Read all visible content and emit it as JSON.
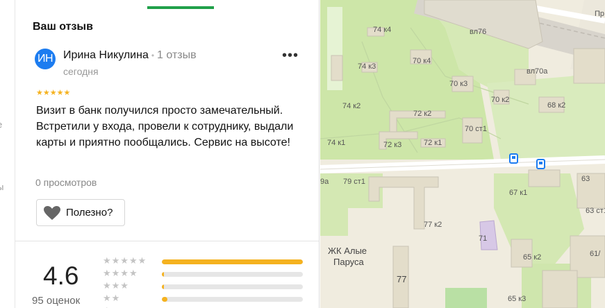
{
  "left_strip": {
    "fragments": [
      "е",
      "ы"
    ]
  },
  "panel": {
    "section_title": "Ваш отзыв",
    "review": {
      "avatar_initials": "ИН",
      "author": "Ирина Никулина",
      "author_reviews": "1 отзыв",
      "date": "сегодня",
      "more_icon": "more-dots-icon",
      "stars": "★★★★★",
      "rating": 5,
      "text": "Визит в банк получился просто замечательный. Встретили у входа, провели к сотруднику, выдали карты и приятно пообщались. Сервис на высоте!",
      "views": "0 просмотров",
      "helpful_label": "Полезно?",
      "helpful_icon": "heart-icon"
    },
    "summary": {
      "rating": "4.6",
      "count": "95 оценок",
      "distribution": [
        {
          "stars": "★★★★★",
          "fraction": 1.0
        },
        {
          "stars": "★★★★",
          "fraction": 0.015
        },
        {
          "stars": "★★★",
          "fraction": 0.015
        },
        {
          "stars": "★★",
          "fraction": 0.04
        },
        {
          "stars": "★",
          "fraction": 0.02
        }
      ]
    }
  },
  "map": {
    "labels": [
      "74 к4",
      "вл76",
      "74 к3",
      "70 к4",
      "вл70а",
      "70 к3",
      "74 к2",
      "70 к2",
      "68 к2",
      "72 к2",
      "70 ст1",
      "74 к1",
      "72 к3",
      "72 к1",
      "79 ст1",
      "9а",
      "67 к1",
      "63",
      "63 ст1",
      "77 к2",
      "71",
      "ЖК Алые",
      "Паруса",
      "65 к2",
      "61/",
      "77",
      "65 к3",
      "Пр"
    ],
    "colors": {
      "park": "#cde6a8",
      "road": "#ffffff",
      "building": "#e3ddca",
      "bus": "#1c7cf0"
    }
  }
}
